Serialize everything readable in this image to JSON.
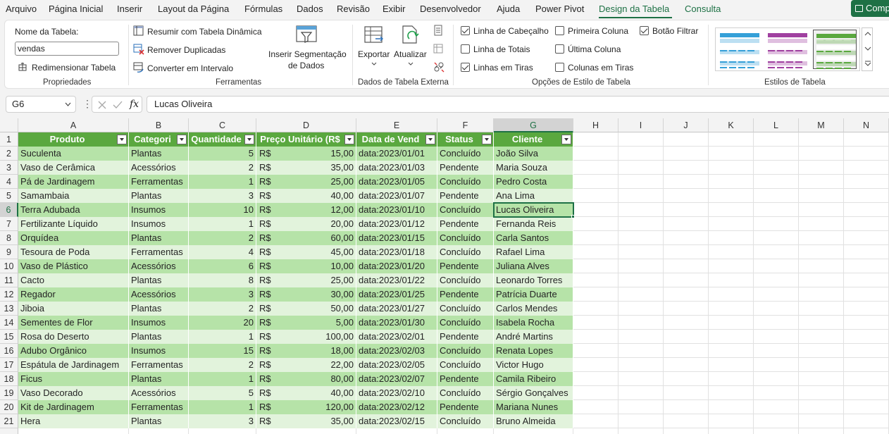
{
  "menu": {
    "items": [
      "Arquivo",
      "Página Inicial",
      "Inserir",
      "Layout da Página",
      "Fórmulas",
      "Dados",
      "Revisão",
      "Exibir",
      "Desenvolvedor",
      "Ajuda",
      "Power Pivot",
      "Design da Tabela",
      "Consulta"
    ],
    "share_label": "Comp"
  },
  "ribbon": {
    "props": {
      "name_label": "Nome da Tabela:",
      "name_value": "vendas",
      "resize_label": "Redimensionar Tabela",
      "group": "Propriedades"
    },
    "tools": {
      "pivot": "Resumir com Tabela Dinâmica",
      "dedupe": "Remover Duplicadas",
      "convert": "Converter em Intervalo",
      "slicer_line1": "Inserir Segmentação",
      "slicer_line2": "de Dados",
      "group": "Ferramentas"
    },
    "external": {
      "export": "Exportar",
      "refresh": "Atualizar",
      "group": "Dados de Tabela Externa"
    },
    "options": {
      "header_row": "Linha de Cabeçalho",
      "total_row": "Linha de Totais",
      "banded_rows": "Linhas em Tiras",
      "first_col": "Primeira Coluna",
      "last_col": "Última Coluna",
      "banded_cols": "Colunas em Tiras",
      "filter_btn": "Botão Filtrar",
      "group": "Opções de Estilo de Tabela",
      "checked": {
        "header_row": true,
        "total_row": false,
        "banded_rows": true,
        "first_col": false,
        "last_col": false,
        "banded_cols": false,
        "filter_btn": true
      }
    },
    "styles": {
      "group": "Estilos de Tabela",
      "colors": [
        "#35a0d8",
        "#a040a0",
        "#5aa83f"
      ]
    }
  },
  "formula_bar": {
    "name_box": "G6",
    "fx": "fx",
    "value": "Lucas Oliveira"
  },
  "grid": {
    "columns": [
      "A",
      "B",
      "C",
      "D",
      "E",
      "F",
      "G",
      "H",
      "I",
      "J",
      "K",
      "L",
      "M",
      "N"
    ],
    "rows": [
      "1",
      "2",
      "3",
      "4",
      "5",
      "6",
      "7",
      "8",
      "9",
      "10",
      "11",
      "12",
      "13",
      "14",
      "15",
      "16",
      "17",
      "18",
      "19",
      "20",
      "21"
    ],
    "selected_col": "G",
    "selected_row": "6"
  },
  "table": {
    "headers": [
      "Produto",
      "Categori",
      "Quantidade",
      "Preço Unitário (R$",
      "Data de Vend",
      "Status",
      "Cliente"
    ],
    "currency": "R$",
    "rows": [
      [
        "Suculenta",
        "Plantas",
        "5",
        "15,00",
        "data:2023/01/01",
        "Concluído",
        "João Silva"
      ],
      [
        "Vaso de Cerâmica",
        "Acessórios",
        "2",
        "35,00",
        "data:2023/01/03",
        "Pendente",
        "Maria Souza"
      ],
      [
        "Pá de Jardinagem",
        "Ferramentas",
        "1",
        "25,00",
        "data:2023/01/05",
        "Concluído",
        "Pedro Costa"
      ],
      [
        "Samambaia",
        "Plantas",
        "3",
        "40,00",
        "data:2023/01/07",
        "Pendente",
        "Ana Lima"
      ],
      [
        "Terra Adubada",
        "Insumos",
        "10",
        "12,00",
        "data:2023/01/10",
        "Concluído",
        "Lucas Oliveira"
      ],
      [
        "Fertilizante Líquido",
        "Insumos",
        "1",
        "20,00",
        "data:2023/01/12",
        "Pendente",
        "Fernanda Reis"
      ],
      [
        "Orquídea",
        "Plantas",
        "2",
        "60,00",
        "data:2023/01/15",
        "Concluído",
        "Carla Santos"
      ],
      [
        "Tesoura de Poda",
        "Ferramentas",
        "4",
        "45,00",
        "data:2023/01/18",
        "Concluído",
        "Rafael Lima"
      ],
      [
        "Vaso de Plástico",
        "Acessórios",
        "6",
        "10,00",
        "data:2023/01/20",
        "Pendente",
        "Juliana Alves"
      ],
      [
        "Cacto",
        "Plantas",
        "8",
        "25,00",
        "data:2023/01/22",
        "Concluído",
        "Leonardo Torres"
      ],
      [
        "Regador",
        "Acessórios",
        "3",
        "30,00",
        "data:2023/01/25",
        "Pendente",
        "Patrícia Duarte"
      ],
      [
        "Jiboia",
        "Plantas",
        "2",
        "50,00",
        "data:2023/01/27",
        "Concluído",
        "Carlos Mendes"
      ],
      [
        "Sementes de Flor",
        "Insumos",
        "20",
        "5,00",
        "data:2023/01/30",
        "Concluído",
        "Isabela Rocha"
      ],
      [
        "Rosa do Deserto",
        "Plantas",
        "1",
        "100,00",
        "data:2023/02/01",
        "Pendente",
        "André Martins"
      ],
      [
        "Adubo Orgânico",
        "Insumos",
        "15",
        "18,00",
        "data:2023/02/03",
        "Concluído",
        "Renata Lopes"
      ],
      [
        "Espátula de Jardinagem",
        "Ferramentas",
        "2",
        "22,00",
        "data:2023/02/05",
        "Concluído",
        "Victor Hugo"
      ],
      [
        "Ficus",
        "Plantas",
        "1",
        "80,00",
        "data:2023/02/07",
        "Pendente",
        "Camila Ribeiro"
      ],
      [
        "Vaso Decorado",
        "Acessórios",
        "5",
        "40,00",
        "data:2023/02/10",
        "Concluído",
        "Sérgio Gonçalves"
      ],
      [
        "Kit de Jardinagem",
        "Ferramentas",
        "1",
        "120,00",
        "data:2023/02/12",
        "Pendente",
        "Mariana Nunes"
      ],
      [
        "Hera",
        "Plantas",
        "3",
        "35,00",
        "data:2023/02/15",
        "Concluído",
        "Bruno Almeida"
      ]
    ]
  }
}
